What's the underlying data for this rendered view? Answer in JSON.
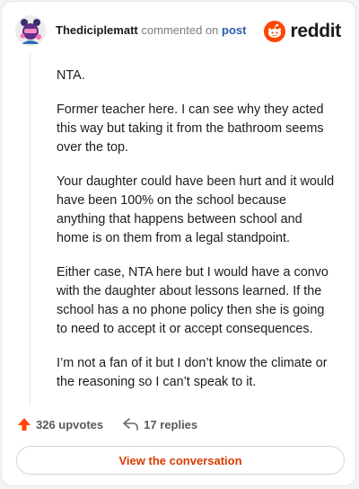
{
  "header": {
    "username": "Thediciplematt",
    "action_text": "commented on",
    "link_text": "post"
  },
  "logo": {
    "wordmark": "reddit",
    "brand_color": "#ff4500"
  },
  "comment": {
    "paragraphs": [
      "NTA.",
      "Former teacher here. I can see why they acted this way but taking it from the bathroom seems over the top.",
      "Your daughter could have been hurt and it would have been 100% on the school because anything that happens between school and home is on them from a legal standpoint.",
      "Either case, NTA here but I would have a convo with the daughter about lessons learned. If the school has a no phone policy then she is going to need to accept it or accept consequences.",
      "I’m not a fan of it but I don’t know the climate or the reasoning so I can’t speak to it."
    ]
  },
  "actions": {
    "upvotes": "326 upvotes",
    "replies": "17 replies",
    "upvote_icon": "upvote-arrow-icon",
    "reply_icon": "reply-arrow-icon"
  },
  "cta": {
    "label": "View the conversation",
    "color": "#d93a00"
  }
}
